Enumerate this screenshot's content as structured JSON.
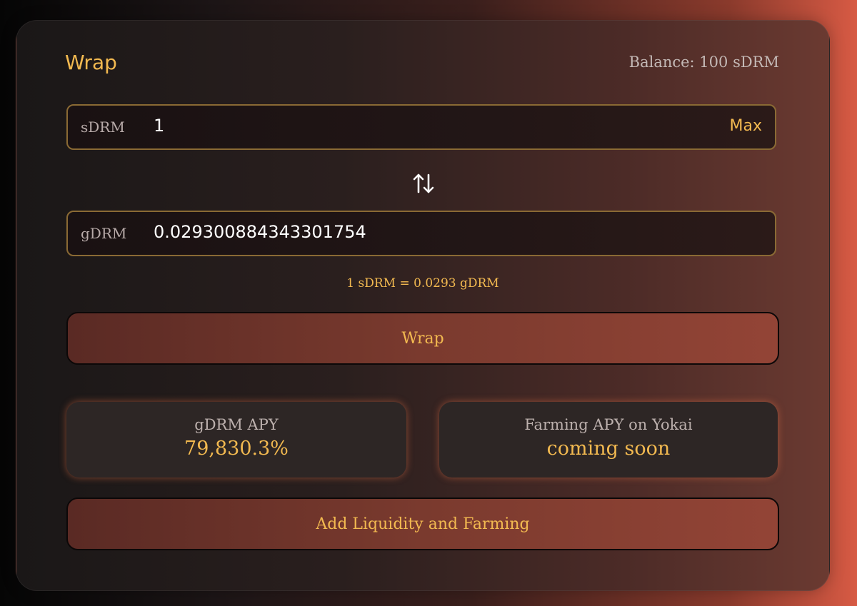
{
  "header": {
    "title": "Wrap",
    "balance": "Balance: 100 sDRM"
  },
  "input_from": {
    "token": "sDRM",
    "value": "1",
    "max_label": "Max"
  },
  "input_to": {
    "token": "gDRM",
    "value": "0.029300884343301754"
  },
  "rate_text": "1 sDRM = 0.0293 gDRM",
  "wrap_button": "Wrap",
  "stats": [
    {
      "label": "gDRM APY",
      "value": "79,830.3%"
    },
    {
      "label": "Farming APY on Yokai",
      "value": "coming soon"
    }
  ],
  "liquidity_button": "Add Liquidity and Farming",
  "colors": {
    "accent": "#f2b950",
    "field_border": "#8a6a34",
    "button": "#7a3a2e"
  },
  "icons": {
    "swap": "swap-arrows-icon"
  }
}
